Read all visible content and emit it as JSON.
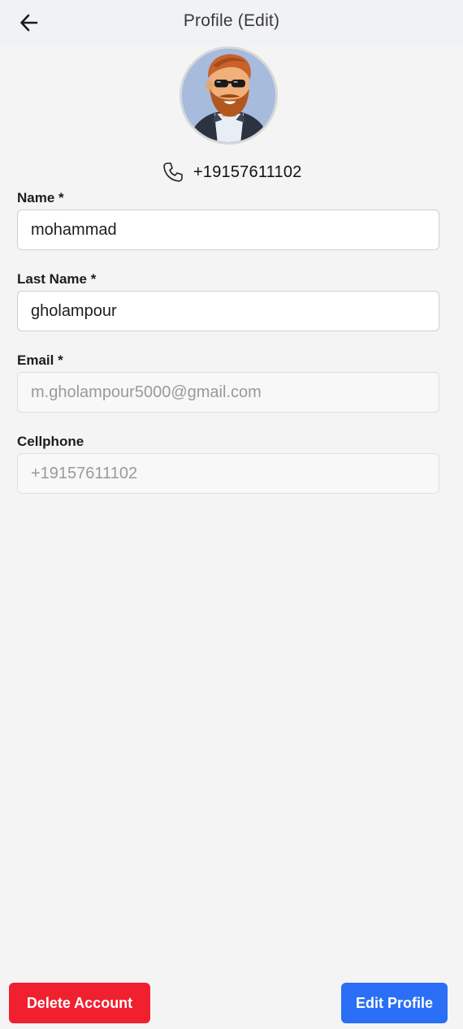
{
  "header": {
    "title": "Profile (Edit)",
    "back_icon": "arrow-left-icon"
  },
  "profile": {
    "avatar_icon": "cartoon-bearded-man-avatar",
    "phone_icon": "phone-icon",
    "phone_display": "+19157611102"
  },
  "form": {
    "name": {
      "label": "Name *",
      "value": "mohammad"
    },
    "last_name": {
      "label": "Last Name *",
      "value": "gholampour"
    },
    "email": {
      "label": "Email *",
      "value": "m.gholampour5000@gmail.com",
      "disabled": true
    },
    "cellphone": {
      "label": "Cellphone",
      "value": "+19157611102",
      "disabled": true
    }
  },
  "actions": {
    "delete_label": "Delete Account",
    "edit_label": "Edit Profile"
  },
  "colors": {
    "danger": "#f0202f",
    "primary": "#2a6ff5",
    "background": "#f4f4f5",
    "header_background": "#f1f2f6"
  }
}
